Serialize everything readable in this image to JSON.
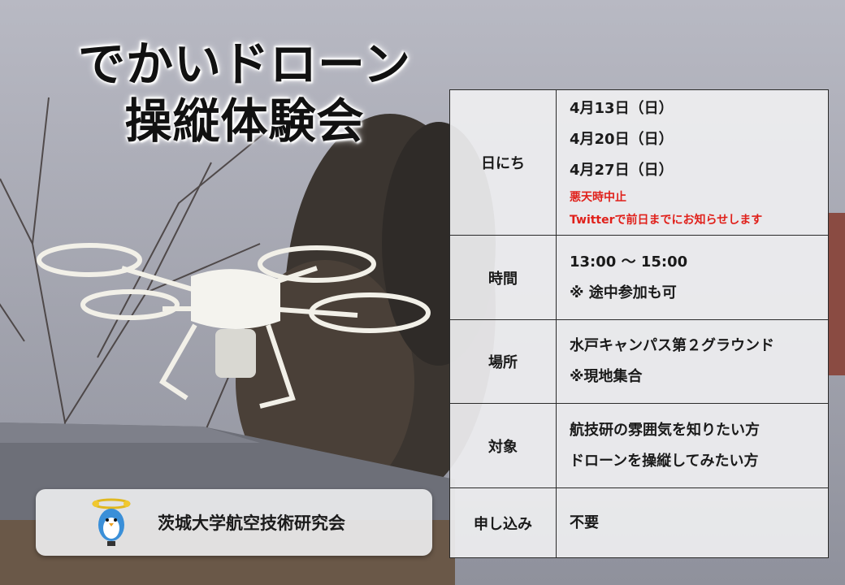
{
  "title": {
    "line1": "でかいドローン",
    "line2": "操縦体験会"
  },
  "organization": {
    "name": "茨城大学航空技術研究会",
    "mascot_icon": "penguin-drone-mascot-icon"
  },
  "table": {
    "date": {
      "label": "日にち",
      "dates": [
        "4月13日（日）",
        "4月20日（日）",
        "4月27日（日）"
      ],
      "notes": [
        "悪天時中止",
        "Twitterで前日までにお知らせします"
      ]
    },
    "time": {
      "label": "時間",
      "lines": [
        "13:00 〜 15:00",
        "※ 途中参加も可"
      ]
    },
    "place": {
      "label": "場所",
      "lines": [
        "水戸キャンパス第２グラウンド",
        "※現地集合"
      ]
    },
    "target": {
      "label": "対象",
      "lines": [
        "航技研の雰囲気を知りたい方",
        "ドローンを操縦してみたい方"
      ]
    },
    "apply": {
      "label": "申し込み",
      "lines": [
        "不要"
      ]
    }
  },
  "colors": {
    "note_red": "#e0201a",
    "panel": "#eeeef0",
    "border": "#2a2a2a"
  }
}
